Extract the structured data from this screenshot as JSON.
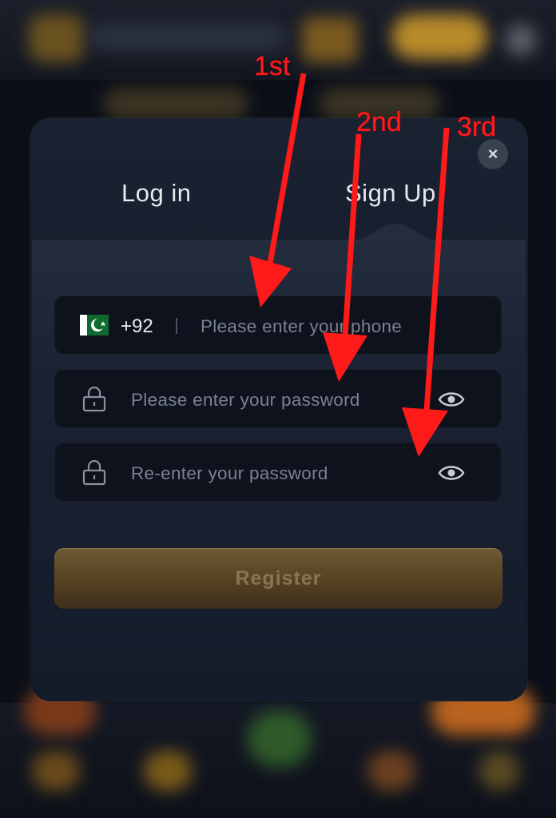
{
  "modal": {
    "close_label": "×",
    "tabs": [
      {
        "label": "Log in",
        "active": false
      },
      {
        "label": "Sign Up",
        "active": true
      }
    ]
  },
  "form": {
    "country_flag": "pakistan-flag",
    "country_code": "+92",
    "phone_placeholder": "Please enter your phone",
    "password_placeholder": "Please enter your password",
    "confirm_placeholder": "Re-enter your password",
    "register_label": "Register"
  },
  "annotations": {
    "first": "1st",
    "second": "2nd",
    "third": "3rd",
    "color": "#ff1a1a"
  },
  "colors": {
    "modal_bg": "#1a2232",
    "field_bg": "#0d121c",
    "register_gold": "#6e5a34"
  }
}
